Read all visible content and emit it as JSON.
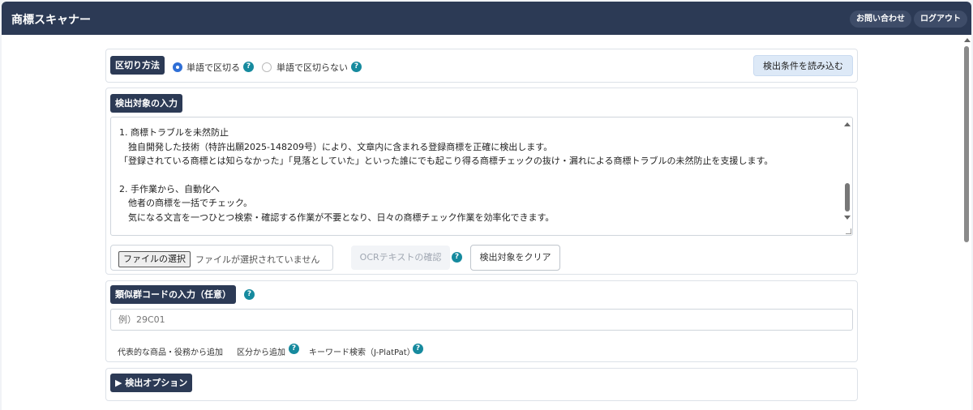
{
  "header": {
    "title": "商標スキャナー",
    "contact_label": "お問い合わせ",
    "logout_label": "ログアウト"
  },
  "split": {
    "label": "区切り方法",
    "option_word": "単語で区切る",
    "option_noword": "単語で区切らない",
    "selected": "単語で区切る",
    "load_button": "検出条件を読み込む"
  },
  "target": {
    "label": "検出対象の入力",
    "lines": [
      "1. 商標トラブルを未然防止",
      "　独自開発した技術（特許出願2025-148209号）により、文章内に含まれる登録商標を正確に検出します。",
      "「登録されている商標とは知らなかった」「見落としていた」といった誰にでも起こり得る商標チェックの抜け・漏れによる商標トラブルの未然防止を支援します。",
      "",
      "2. 手作業から、自動化へ",
      "　他者の商標を一括でチェック。",
      "　気になる文言を一つひとつ検索・確認する作業が不要となり、日々の商標チェック作業を効率化できます。"
    ],
    "file_button": "ファイルの選択",
    "file_status": "ファイルが選択されていません",
    "ocr_button": "OCRテキストの確認",
    "clear_button": "検出対象をクリア"
  },
  "similar": {
    "label": "類似群コードの入力（任意）",
    "placeholder": "例）29C01",
    "link_goods": "代表的な商品・役務から追加",
    "link_class": "区分から追加",
    "link_keyword": "キーワード検索（J-PlatPat）"
  },
  "options": {
    "label": "▶ 検出オプション"
  },
  "colors": {
    "header_bg": "#2c3a55",
    "section_label_bg": "#2c3a55",
    "radio_accent": "#2f6fd6",
    "help_icon": "#168a9e",
    "load_button_bg": "#dde9f7"
  },
  "icons": {
    "help": "question-circle-icon"
  }
}
